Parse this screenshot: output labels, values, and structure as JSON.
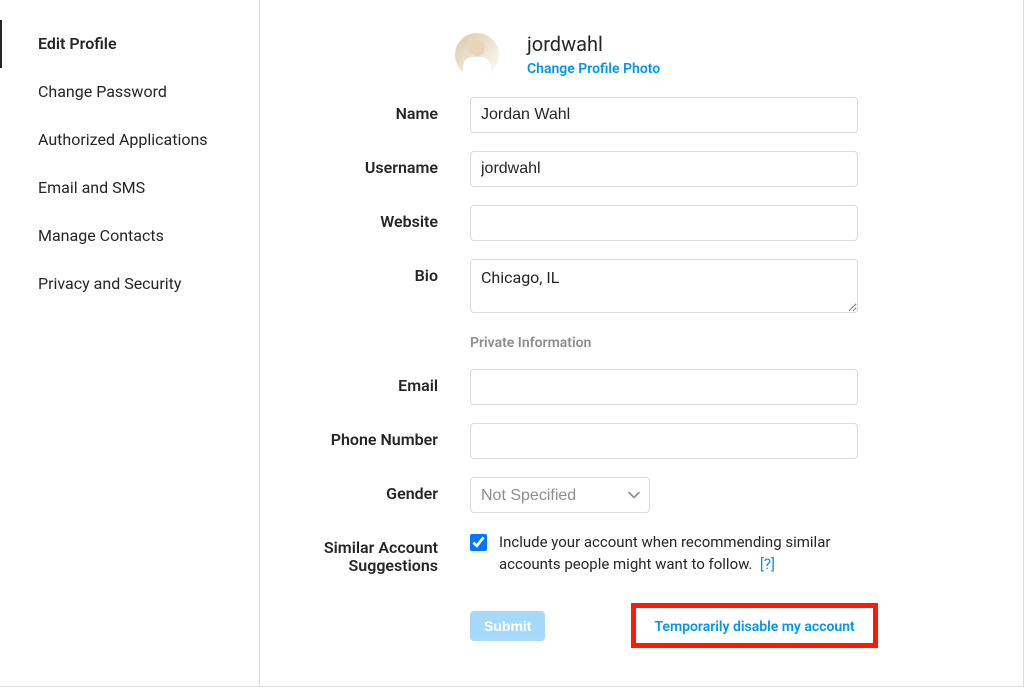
{
  "sidebar": {
    "items": [
      {
        "label": "Edit Profile",
        "active": true
      },
      {
        "label": "Change Password",
        "active": false
      },
      {
        "label": "Authorized Applications",
        "active": false
      },
      {
        "label": "Email and SMS",
        "active": false
      },
      {
        "label": "Manage Contacts",
        "active": false
      },
      {
        "label": "Privacy and Security",
        "active": false
      }
    ]
  },
  "profile": {
    "username": "jordwahl",
    "change_photo_label": "Change Profile Photo"
  },
  "labels": {
    "name": "Name",
    "username": "Username",
    "website": "Website",
    "bio": "Bio",
    "private_info": "Private Information",
    "email": "Email",
    "phone": "Phone Number",
    "gender": "Gender",
    "suggestions": "Similar Account Suggestions"
  },
  "values": {
    "name": "Jordan Wahl",
    "username": "jordwahl",
    "website": "",
    "bio": "Chicago, IL",
    "email": "",
    "phone": "",
    "gender_selected": "Not Specified",
    "suggestions_checked": true
  },
  "suggestions_text": "Include your account when recommending similar accounts people might want to follow.",
  "help_link": "[?]",
  "actions": {
    "submit": "Submit",
    "disable": "Temporarily disable my account"
  }
}
